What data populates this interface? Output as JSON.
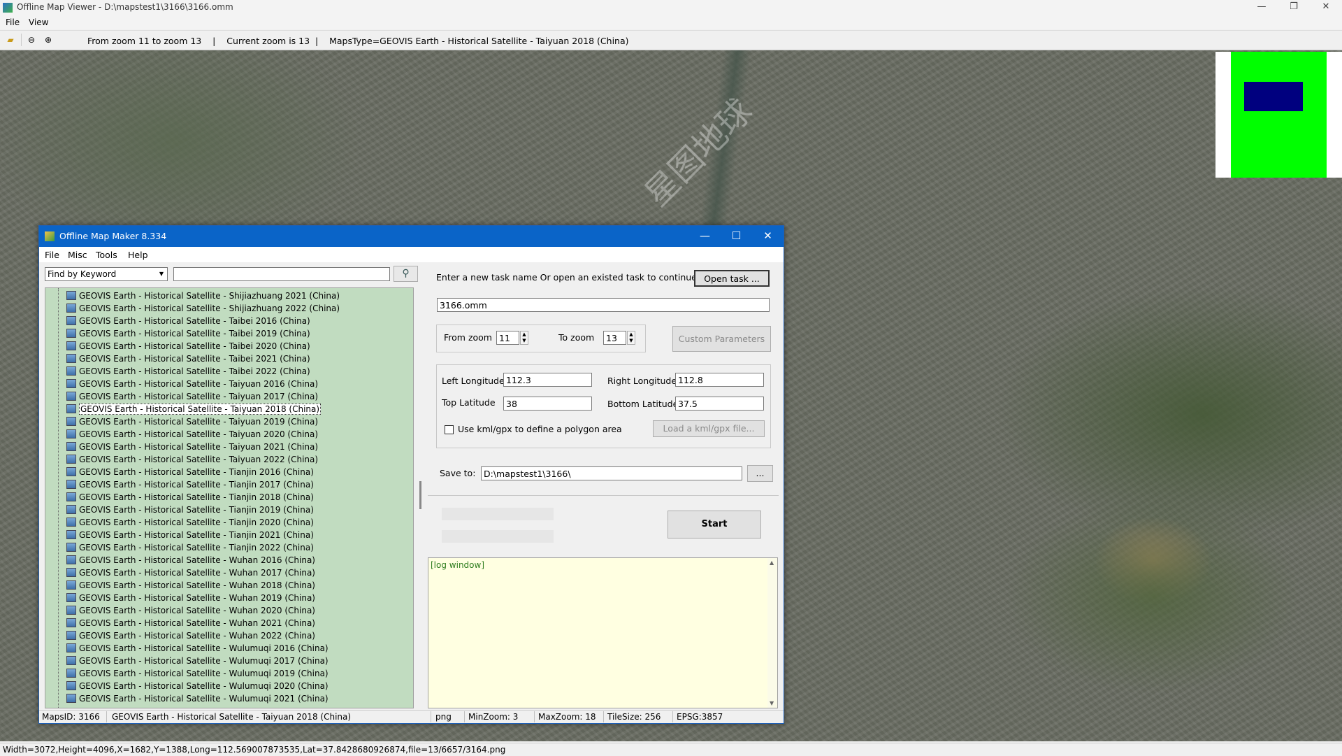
{
  "outer": {
    "title": "Offline Map Viewer - D:\\mapstest1\\3166\\3166.omm",
    "menu": [
      "File",
      "View"
    ],
    "toolbar_text": "From zoom 11 to zoom 13    |    Current zoom is 13  |    MapsType=GEOVIS Earth - Historical Satellite - Taiyuan 2018 (China)",
    "status": "Width=3072,Height=4096,X=1682,Y=1388,Long=112.569007873535,Lat=37.8428680926874,file=13/6657/3164.png",
    "win_min": "—",
    "win_max": "❐",
    "win_close": "✕",
    "watermark": "星图地球"
  },
  "dialog": {
    "title": "Offline Map Maker 8.334",
    "menu": [
      "File",
      "Misc",
      "Tools",
      "Help"
    ],
    "btn_min": "—",
    "btn_max": "☐",
    "btn_close": "✕",
    "find_select": "Find by Keyword",
    "search_value": "",
    "map_list": [
      "GEOVIS Earth - Historical Satellite - Shijiazhuang 2021 (China)",
      "GEOVIS Earth - Historical Satellite - Shijiazhuang 2022 (China)",
      "GEOVIS Earth - Historical Satellite - Taibei 2016 (China)",
      "GEOVIS Earth - Historical Satellite - Taibei 2019 (China)",
      "GEOVIS Earth - Historical Satellite - Taibei 2020 (China)",
      "GEOVIS Earth - Historical Satellite - Taibei 2021 (China)",
      "GEOVIS Earth - Historical Satellite - Taibei 2022 (China)",
      "GEOVIS Earth - Historical Satellite - Taiyuan 2016 (China)",
      "GEOVIS Earth - Historical Satellite - Taiyuan 2017 (China)",
      "GEOVIS Earth - Historical Satellite - Taiyuan 2018 (China)",
      "GEOVIS Earth - Historical Satellite - Taiyuan 2019 (China)",
      "GEOVIS Earth - Historical Satellite - Taiyuan 2020 (China)",
      "GEOVIS Earth - Historical Satellite - Taiyuan 2021 (China)",
      "GEOVIS Earth - Historical Satellite - Taiyuan 2022 (China)",
      "GEOVIS Earth - Historical Satellite - Tianjin 2016 (China)",
      "GEOVIS Earth - Historical Satellite - Tianjin 2017 (China)",
      "GEOVIS Earth - Historical Satellite - Tianjin 2018 (China)",
      "GEOVIS Earth - Historical Satellite - Tianjin 2019 (China)",
      "GEOVIS Earth - Historical Satellite - Tianjin 2020 (China)",
      "GEOVIS Earth - Historical Satellite - Tianjin 2021 (China)",
      "GEOVIS Earth - Historical Satellite - Tianjin 2022 (China)",
      "GEOVIS Earth - Historical Satellite - Wuhan 2016 (China)",
      "GEOVIS Earth - Historical Satellite - Wuhan 2017 (China)",
      "GEOVIS Earth - Historical Satellite - Wuhan 2018 (China)",
      "GEOVIS Earth - Historical Satellite - Wuhan 2019 (China)",
      "GEOVIS Earth - Historical Satellite - Wuhan 2020 (China)",
      "GEOVIS Earth - Historical Satellite - Wuhan 2021 (China)",
      "GEOVIS Earth - Historical Satellite - Wuhan 2022 (China)",
      "GEOVIS Earth - Historical Satellite - Wulumuqi 2016 (China)",
      "GEOVIS Earth - Historical Satellite - Wulumuqi 2017 (China)",
      "GEOVIS Earth - Historical Satellite - Wulumuqi 2019 (China)",
      "GEOVIS Earth - Historical Satellite - Wulumuqi 2020 (China)",
      "GEOVIS Earth - Historical Satellite - Wulumuqi 2021 (China)"
    ],
    "selected_index": 9,
    "task_prompt": "Enter a new task name Or open an existed task to continue:",
    "open_task": "Open task ...",
    "task_name": "3166.omm",
    "from_zoom_label": "From zoom",
    "from_zoom": "11",
    "to_zoom_label": "To zoom",
    "to_zoom": "13",
    "custom_params": "Custom Parameters",
    "left_lon_label": "Left Longitude",
    "left_lon": "112.3",
    "right_lon_label": "Right Longitude",
    "right_lon": "112.8",
    "top_lat_label": "Top Latitude",
    "top_lat": "38",
    "bottom_lat_label": "Bottom Latitude",
    "bottom_lat": "37.5",
    "kml_label": "Use kml/gpx to define a polygon area",
    "load_kml": "Load a kml/gpx file...",
    "save_to_label": "Save to:",
    "save_to": "D:\\mapstest1\\3166\\",
    "browse": "...",
    "start": "Start",
    "log_text": "[log window]",
    "status": {
      "maps_id": "MapsID: 3166",
      "map_name": "GEOVIS Earth - Historical Satellite - Taiyuan 2018 (China)",
      "format": "png",
      "min_zoom": "MinZoom: 3",
      "max_zoom": "MaxZoom: 18",
      "tile_size": "TileSize: 256",
      "epsg": "EPSG:3857"
    }
  },
  "colors": {
    "title_bar": "#0a64c8",
    "list_bg": "#c1dcc0",
    "log_bg": "#ffffe1",
    "minimap_green": "#00ff00",
    "minimap_blue": "#00007f"
  }
}
